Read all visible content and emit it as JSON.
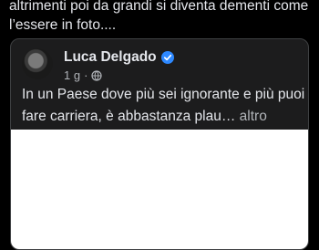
{
  "post": {
    "text_line1": "altrimenti poi da grandi si diventa dementi come",
    "text_line2": "l’essere in foto...."
  },
  "shared": {
    "author": "Luca Delgado",
    "time": "1 g",
    "separator": "·",
    "text_line1": "In un Paese dove più sei ignorante e più puoi",
    "text_line2_main": "fare carriera, è abbastanza plau…",
    "more_label": "altro",
    "verified_color": "#2d88ff"
  },
  "colors": {
    "background": "#000000",
    "card_border": "#3e4042",
    "primary_text": "#e4e6eb",
    "secondary_text": "#b0b3b8"
  }
}
